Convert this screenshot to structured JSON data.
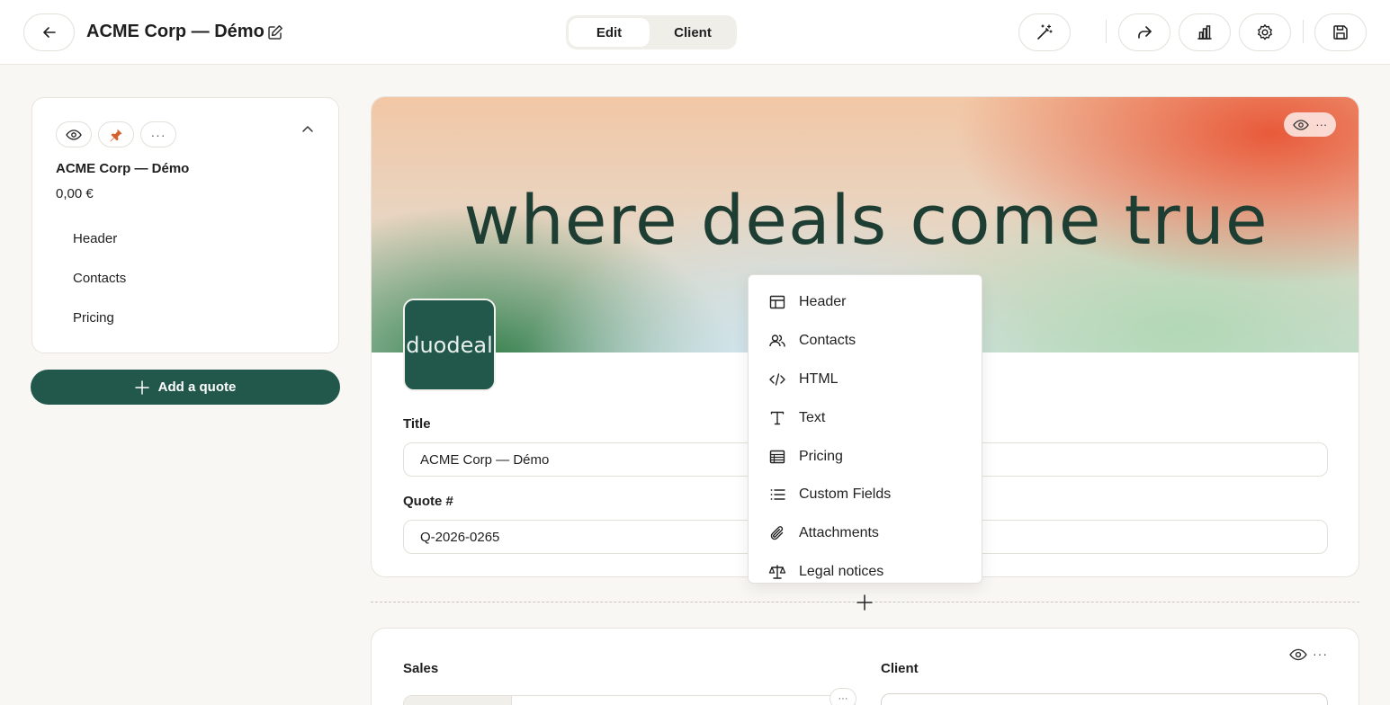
{
  "topbar": {
    "title": "ACME Corp — Démo",
    "modes": [
      "Edit",
      "Client"
    ],
    "active_mode": "Edit"
  },
  "sidebar": {
    "quote_name": "ACME Corp — Démo",
    "amount": "0,00 €",
    "nav_items": [
      "Header",
      "Contacts",
      "Pricing"
    ],
    "add_quote_label": "Add a quote"
  },
  "header_block": {
    "hero_text": "where deals come true",
    "logo_text": "duodeal",
    "title_label": "Title",
    "title_value": "ACME Corp — Démo",
    "quote_number_label": "Quote #",
    "quote_number_value": "Q-2026-0265"
  },
  "add_block_menu": {
    "items": [
      {
        "label": "Header",
        "icon": "layout-icon"
      },
      {
        "label": "Contacts",
        "icon": "users-icon"
      },
      {
        "label": "HTML",
        "icon": "code-icon"
      },
      {
        "label": "Text",
        "icon": "text-icon"
      },
      {
        "label": "Pricing",
        "icon": "table-icon"
      },
      {
        "label": "Custom Fields",
        "icon": "list-icon"
      },
      {
        "label": "Attachments",
        "icon": "paperclip-icon"
      },
      {
        "label": "Legal notices",
        "icon": "scale-icon"
      }
    ]
  },
  "contacts_block": {
    "sales_label": "Sales",
    "client_label": "Client"
  },
  "colors": {
    "brand_green": "#22574b",
    "pin_orange": "#d4622f",
    "background": "#f9f7f3"
  }
}
